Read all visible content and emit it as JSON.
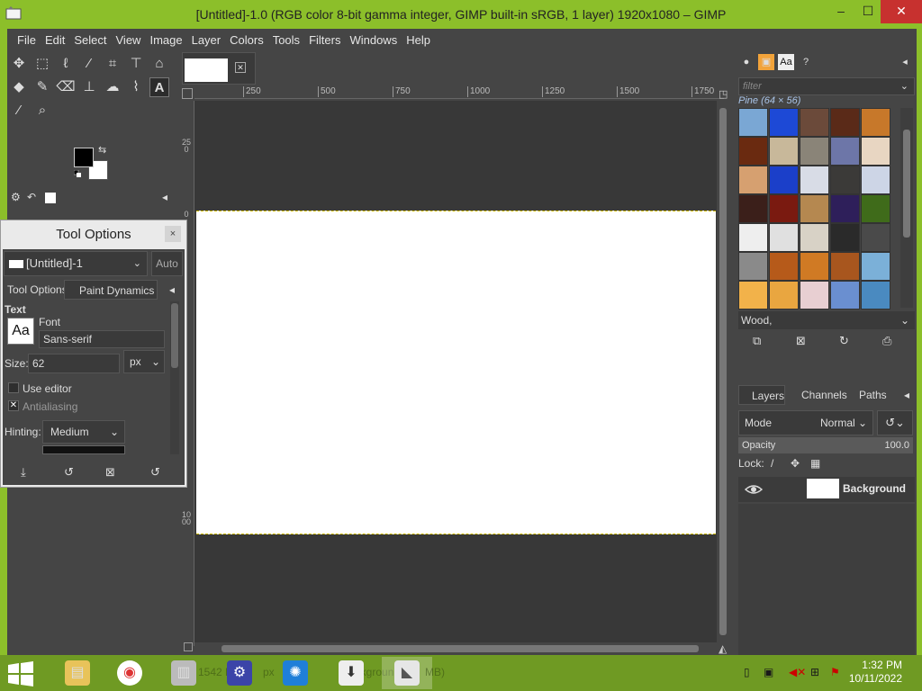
{
  "window": {
    "title": "[Untitled]-1.0 (RGB color 8-bit gamma integer, GIMP built-in sRGB, 1 layer) 1920x1080 – GIMP",
    "minimize": "–",
    "maximize": "☐",
    "close": "✕"
  },
  "menu": [
    "File",
    "Edit",
    "Select",
    "View",
    "Image",
    "Layer",
    "Colors",
    "Tools",
    "Filters",
    "Windows",
    "Help"
  ],
  "tool_options": {
    "title": "Tool Options",
    "close": "×",
    "image": "[Untitled]-1",
    "auto": "Auto",
    "tab1": "Tool Options",
    "tab2": "Paint Dynamics",
    "section": "Text",
    "font_label": "Font",
    "font_preview": "Aa",
    "font_value": "Sans-serif",
    "size_label": "Size:",
    "size_value": "62",
    "size_unit": "px",
    "use_editor": "Use editor",
    "antialiasing": "Antialiasing",
    "hinting_label": "Hinting:",
    "hinting_value": "Medium"
  },
  "ruler": {
    "h_ticks": [
      "250",
      "500",
      "750",
      "1000",
      "1250",
      "1500",
      "1750"
    ],
    "v_ticks": [
      "250",
      "0",
      "1000"
    ]
  },
  "patterns": {
    "filter_placeholder": "filter",
    "selected_name": "Pine (64 × 56)",
    "selected_tag": "Wood,",
    "colors": [
      [
        "#7aa7d4",
        "#1d49d6",
        "#6b4a3a",
        "#5a2a18",
        "#c7782a"
      ],
      [
        "#6a2a10",
        "#c8b89a",
        "#8a8478",
        "#6d76a8",
        "#e8d6c2"
      ],
      [
        "#d6a070",
        "#1b3fc9",
        "#d8dce6",
        "#3b3a38",
        "#cdd5e6"
      ],
      [
        "#3b1f1a",
        "#7a1a10",
        "#b58850",
        "#2e1f5a",
        "#3f6b1a"
      ],
      [
        "#eeeeee",
        "#e0e0e0",
        "#d8d2c6",
        "#2a2a2a",
        "#4a4a4a"
      ],
      [
        "#8a8a8a",
        "#b65a1a",
        "#d07a24",
        "#a8561e",
        "#7bb0d8"
      ],
      [
        "#f2b24a",
        "#e9a640",
        "#e8cfd2",
        "#6a8fd0",
        "#4a8ac0"
      ]
    ]
  },
  "layers": {
    "tab_layers": "Layers",
    "tab_channels": "Channels",
    "tab_paths": "Paths",
    "mode_label": "Mode",
    "mode_value": "Normal",
    "opacity_label": "Opacity",
    "opacity_value": "100.0",
    "lock_label": "Lock:",
    "items": [
      {
        "name": "Background"
      }
    ]
  },
  "taskbar": {
    "ghost_1": "1542 E",
    "ghost_2": "px",
    "ghost_3": "Backgroun",
    "ghost_4": "MB)",
    "time": "1:32 PM",
    "date": "10/11/2022"
  }
}
